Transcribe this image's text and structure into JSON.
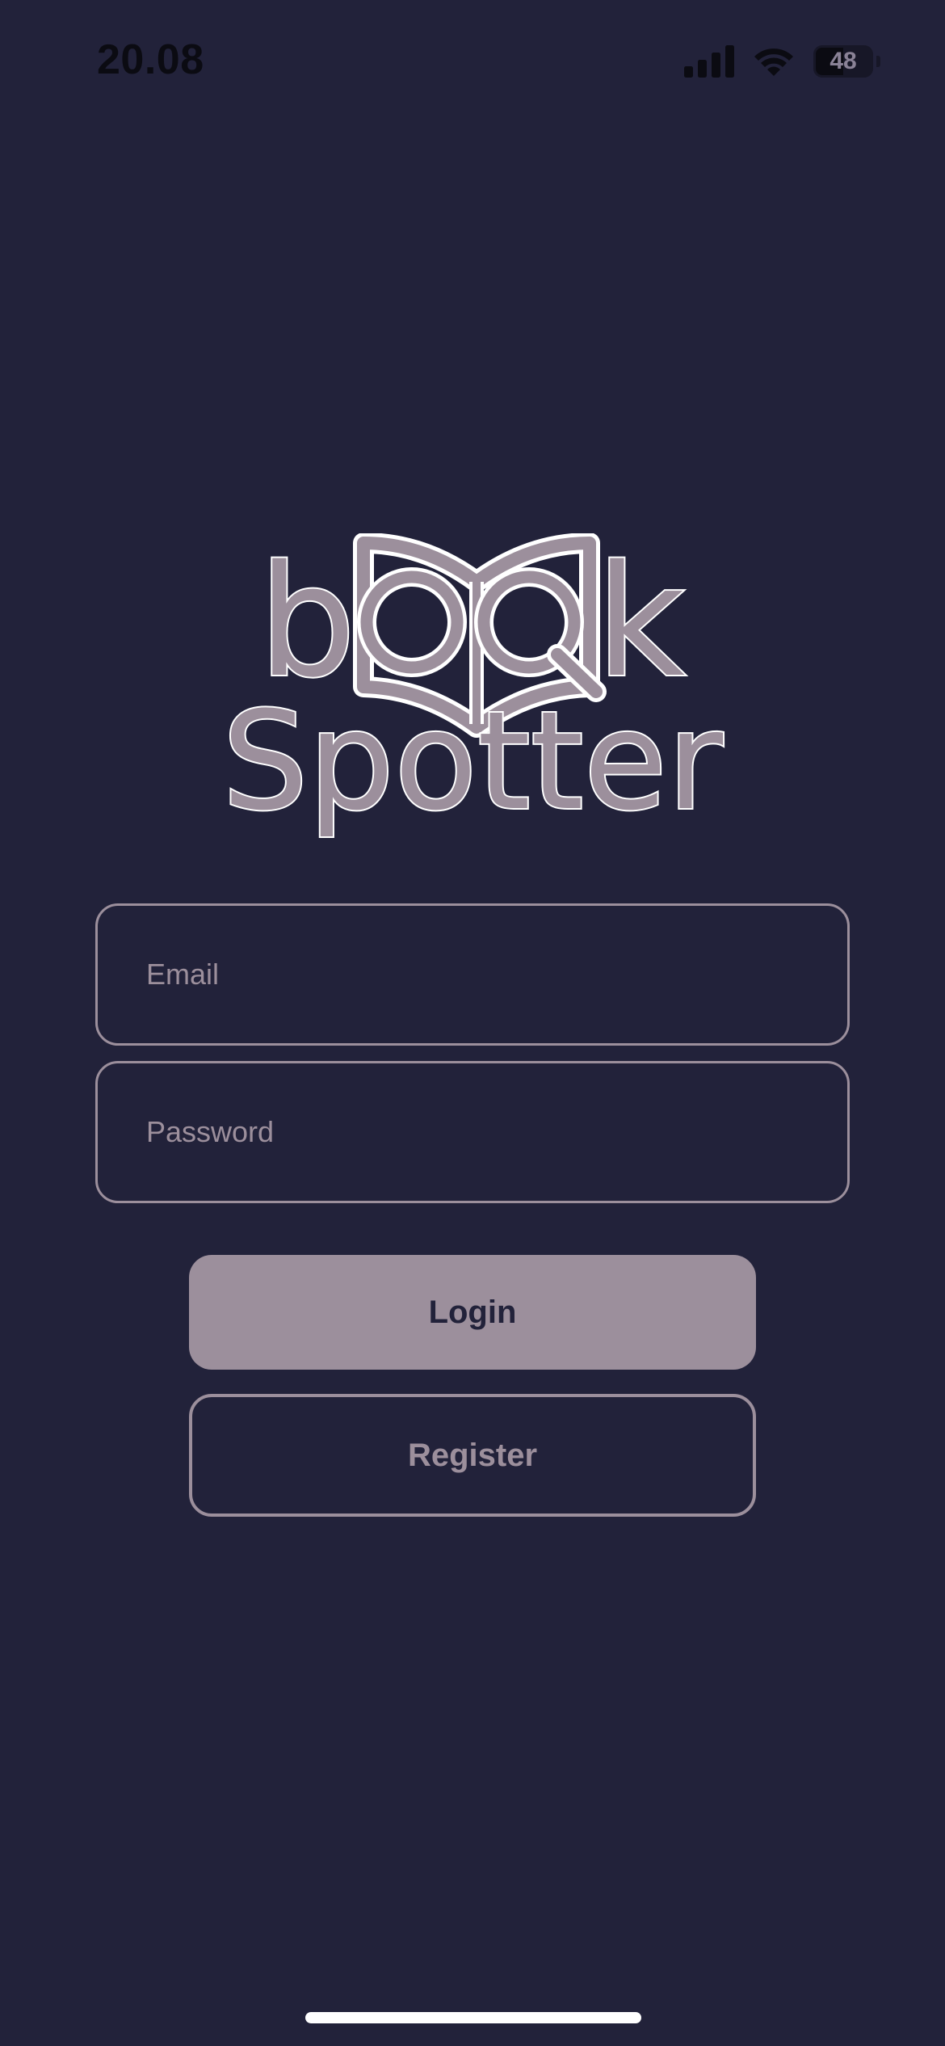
{
  "status_bar": {
    "time": "20.08",
    "battery_level": "48"
  },
  "logo": {
    "line1_prefix": "b",
    "line1_suffix": "k",
    "line2": "Spotter",
    "icon": "open-book-magnifier-icon"
  },
  "form": {
    "email_placeholder": "Email",
    "password_placeholder": "Password"
  },
  "buttons": {
    "login_label": "Login",
    "register_label": "Register"
  },
  "colors": {
    "background": "#22223a",
    "accent": "#9c8f9c",
    "logo_outline": "#ffffff"
  }
}
